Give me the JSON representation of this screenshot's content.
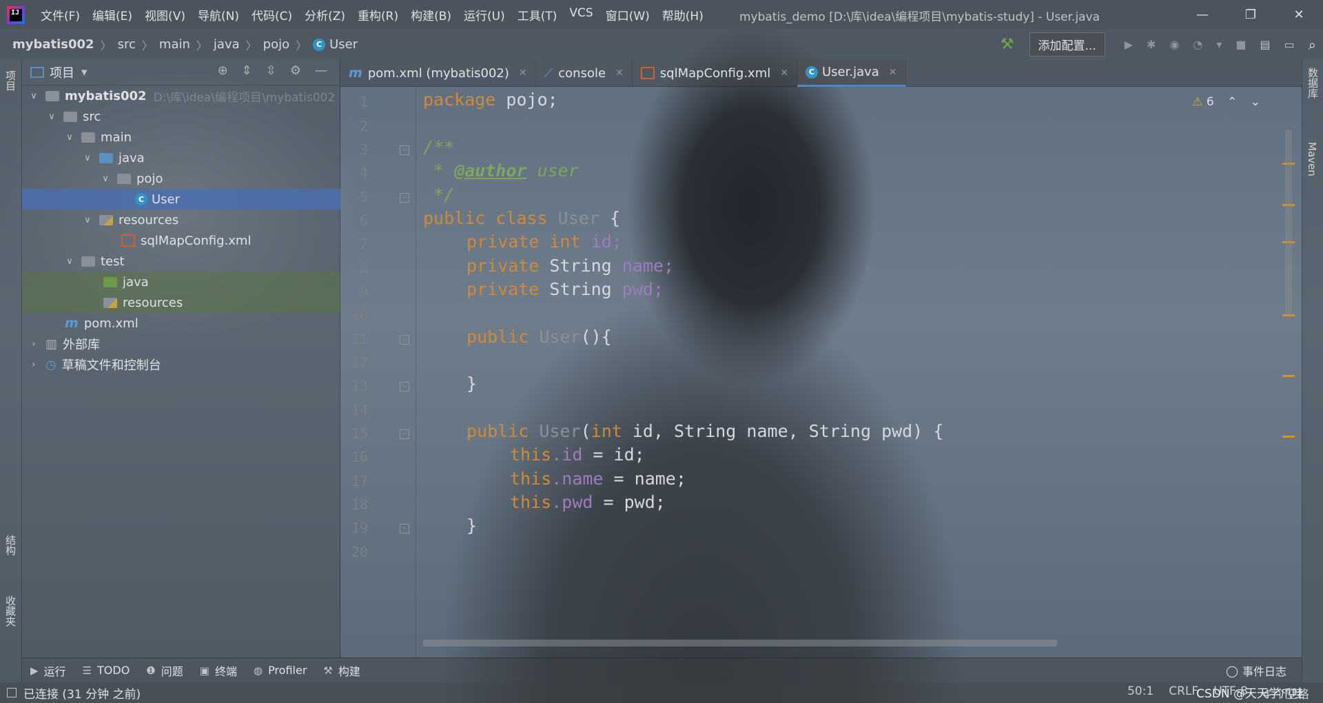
{
  "app": {
    "logo": "IJ",
    "title": "mybatis_demo [D:\\库\\idea\\编程项目\\mybatis-study] - User.java"
  },
  "menu": [
    "文件(F)",
    "编辑(E)",
    "视图(V)",
    "导航(N)",
    "代码(C)",
    "分析(Z)",
    "重构(R)",
    "构建(B)",
    "运行(U)",
    "工具(T)",
    "VCS",
    "窗口(W)",
    "帮助(H)"
  ],
  "window_controls": {
    "minimize": "—",
    "restore": "❐",
    "close": "✕"
  },
  "breadcrumb": [
    "mybatis002",
    "src",
    "main",
    "java",
    "pojo",
    "User"
  ],
  "navbar": {
    "add_config": "添加配置..."
  },
  "left_tabs": [
    "项目",
    "结构",
    "收藏夹"
  ],
  "right_tabs": [
    "数据库",
    "Maven"
  ],
  "project_panel": {
    "title": "项目"
  },
  "tree": [
    {
      "label": "mybatis002",
      "path": "D:\\库\\idea\\编程项目\\mybatis002",
      "icon": "module-folder-icon",
      "arrow": "v"
    },
    {
      "label": "src",
      "icon": "folder-icon",
      "arrow": "v"
    },
    {
      "label": "main",
      "icon": "folder-icon",
      "arrow": "v"
    },
    {
      "label": "java",
      "icon": "source-folder-icon",
      "arrow": "v"
    },
    {
      "label": "pojo",
      "icon": "package-icon",
      "arrow": "v"
    },
    {
      "label": "User",
      "icon": "class-icon",
      "arrow": ""
    },
    {
      "label": "resources",
      "icon": "resources-folder-icon",
      "arrow": "v"
    },
    {
      "label": "sqlMapConfig.xml",
      "icon": "xml-file-icon",
      "arrow": ""
    },
    {
      "label": "test",
      "icon": "folder-icon",
      "arrow": "v"
    },
    {
      "label": "java",
      "icon": "test-folder-icon",
      "arrow": ""
    },
    {
      "label": "resources",
      "icon": "test-resources-icon",
      "arrow": ""
    },
    {
      "label": "pom.xml",
      "icon": "maven-icon",
      "arrow": ""
    },
    {
      "label": "外部库",
      "icon": "library-icon",
      "arrow": ">"
    },
    {
      "label": "草稿文件和控制台",
      "icon": "scratch-icon",
      "arrow": ">"
    }
  ],
  "tabs": [
    {
      "label": "pom.xml (mybatis002)",
      "icon": "maven-icon"
    },
    {
      "label": "console",
      "icon": "console-icon"
    },
    {
      "label": "sqlMapConfig.xml",
      "icon": "xml-file-icon"
    },
    {
      "label": "User.java",
      "icon": "class-icon",
      "active": true
    }
  ],
  "warnings": {
    "count": "6"
  },
  "line_numbers": [
    "1",
    "2",
    "3",
    "4",
    "5",
    "6",
    "7",
    "8",
    "9",
    "10",
    "11",
    "12",
    "13",
    "14",
    "15",
    "16",
    "17",
    "18",
    "19",
    "20"
  ],
  "code": {
    "l1": {
      "kw": "package",
      "rest": " pojo;"
    },
    "l3": "/**",
    "l4": {
      "a": " * ",
      "tag": "@author",
      "b": " user"
    },
    "l5": " */",
    "l6": {
      "kw": "public class",
      "name": " User",
      "rest": " {"
    },
    "l7": {
      "kw": "private int",
      "fld": " id;"
    },
    "l8": {
      "kw": "private",
      "type": " String",
      "fld": " name;"
    },
    "l9": {
      "kw": "private",
      "type": " String",
      "fld": " pwd;"
    },
    "l11": {
      "kw": "public",
      "name": " User",
      "rest": "(){"
    },
    "l13": "}",
    "l15": {
      "kw": "public",
      "name": " User",
      "a": "(",
      "kw2": "int",
      "b": " id, String name, String pwd) {"
    },
    "l16": {
      "kw": "this",
      "fld": ".id",
      "rest": " = id;"
    },
    "l17": {
      "kw": "this",
      "fld": ".name",
      "rest": " = name;"
    },
    "l18": {
      "kw": "this",
      "fld": ".pwd",
      "rest": " = pwd;"
    },
    "l19": "}"
  },
  "bottom_tools": [
    {
      "label": "运行",
      "icon": "run-icon"
    },
    {
      "label": "TODO",
      "icon": "todo-icon"
    },
    {
      "label": "问题",
      "icon": "problems-icon"
    },
    {
      "label": "终端",
      "icon": "terminal-icon"
    },
    {
      "label": "Profiler",
      "icon": "profiler-icon"
    },
    {
      "label": "构建",
      "icon": "build-icon"
    }
  ],
  "event_log": "事件日志",
  "status": {
    "left": "已连接 (31 分钟 之前)",
    "position": "50:1",
    "line_sep": "CRLF",
    "encoding": "UTF-8",
    "indent": "4 个空格",
    "watermark": "CSDN @天天学爪哇"
  }
}
